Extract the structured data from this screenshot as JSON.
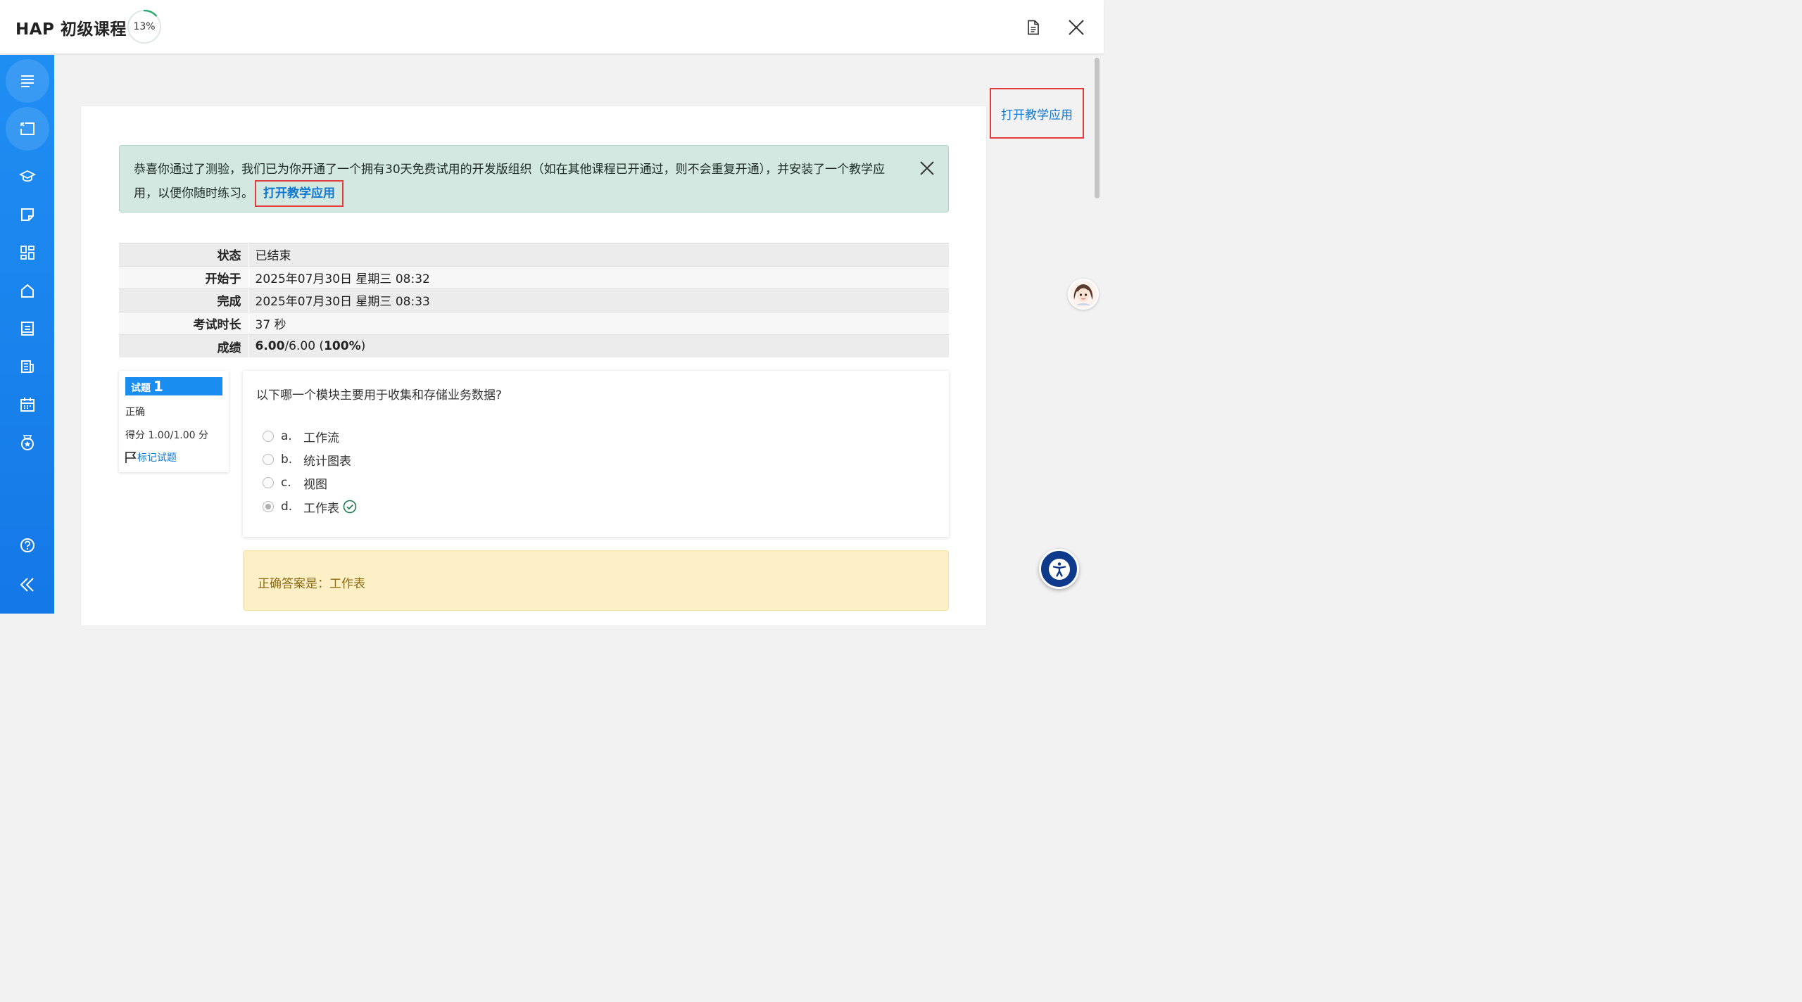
{
  "header": {
    "title": "HAP 初级课程",
    "progress_text": "13%",
    "progress_value": 0.13
  },
  "sidebar": {
    "items": [
      {
        "icon": "list-icon"
      },
      {
        "icon": "exit-icon"
      },
      {
        "icon": "graduation-cap-icon"
      },
      {
        "icon": "note-icon"
      },
      {
        "icon": "grid-icon"
      },
      {
        "icon": "home-icon"
      },
      {
        "icon": "book-icon"
      },
      {
        "icon": "news-icon"
      },
      {
        "icon": "calendar-icon"
      },
      {
        "icon": "medal-icon"
      },
      {
        "icon": "help-icon"
      },
      {
        "icon": "collapse-icon"
      }
    ]
  },
  "alert": {
    "message": "恭喜你通过了测验，我们已为你开通了一个拥有30天免费试用的开发版组织（如在其他课程已开通过，则不会重复开通），并安装了一个教学应用，以便你随时练习。",
    "link_label": "打开教学应用"
  },
  "right_link": {
    "label": "打开教学应用"
  },
  "summary": {
    "rows": [
      {
        "key": "状态",
        "value": "已结束"
      },
      {
        "key": "开始于",
        "value": "2025年07月30日 星期三 08:32"
      },
      {
        "key": "完成",
        "value": "2025年07月30日 星期三 08:33"
      },
      {
        "key": "考试时长",
        "value": "37 秒"
      }
    ],
    "grade_key": "成绩",
    "grade_score": "6.00",
    "grade_total": "/6.00 (",
    "grade_percent": "100%",
    "grade_close": ")"
  },
  "question": {
    "label": "试题",
    "number": "1",
    "status": "正确",
    "score": "得分 1.00/1.00 分",
    "flag_label": "标记试题",
    "text": "以下哪一个模块主要用于收集和存储业务数据?",
    "options": [
      {
        "letter": "a.",
        "text": "工作流",
        "selected": false
      },
      {
        "letter": "b.",
        "text": "统计图表",
        "selected": false
      },
      {
        "letter": "c.",
        "text": "视图",
        "selected": false
      },
      {
        "letter": "d.",
        "text": "工作表",
        "selected": true
      }
    ]
  },
  "answer": {
    "text": "正确答案是：工作表"
  },
  "colors": {
    "sidebar": "#1a86ef",
    "link": "#1177d1",
    "highlight_border": "#e03c3c",
    "correct": "#1e7a4f"
  }
}
